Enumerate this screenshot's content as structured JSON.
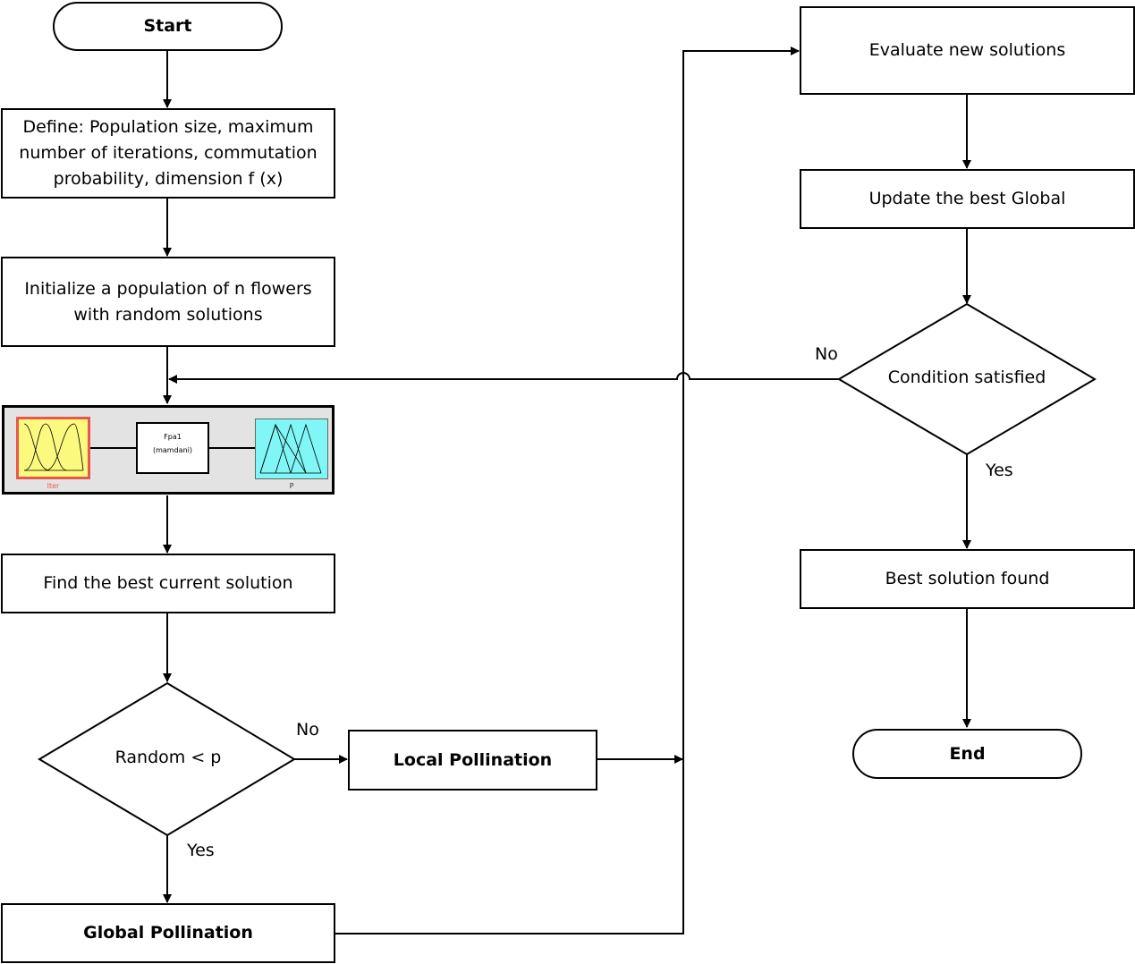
{
  "nodes": {
    "start": "Start",
    "define_l1": "Define: Population size, maximum",
    "define_l2": "number of iterations, commutation",
    "define_l3": "probability, dimension f (x)",
    "init_l1": "Initialize a population of n flowers",
    "init_l2": "with random solutions",
    "find_best": "Find the best current solution",
    "random_decision": "Random < p",
    "local_pollination": "Local Pollination",
    "global_pollination": "Global Pollination",
    "evaluate": "Evaluate new solutions",
    "update_global": "Update the best Global",
    "condition": "Condition satisfied",
    "best_found": "Best solution found",
    "end": "End"
  },
  "fuzzy_system": {
    "input_label": "Iter",
    "system_name": "Fpa1",
    "system_type": "(mamdani)",
    "output_label": "P",
    "colors": {
      "input_fill": "#fcfa7e",
      "input_border": "#e8584a",
      "output_fill": "#80f6f6",
      "panel": "#e3e3e3"
    }
  },
  "edge_labels": {
    "random_no": "No",
    "random_yes": "Yes",
    "condition_no": "No",
    "condition_yes": "Yes"
  }
}
